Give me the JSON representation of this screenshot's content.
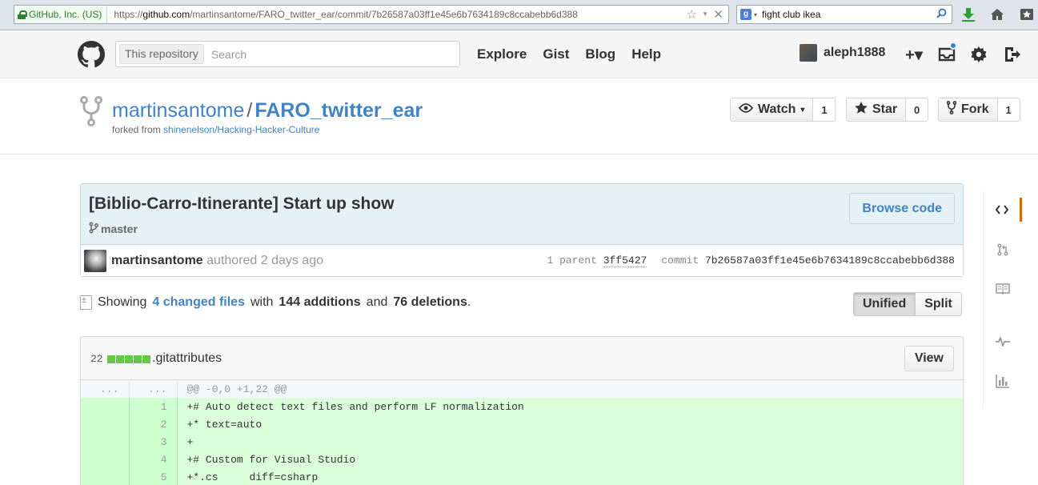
{
  "browser": {
    "site_identity": "GitHub, Inc. (US)",
    "url_prefix": "https://",
    "url_domain": "github.com",
    "url_path": "/martinsantome/FARO_twitter_ear/commit/7b26587a03ff1e45e6b7634189c8ccabebb6d388",
    "search_value": "fight club ikea"
  },
  "header": {
    "search_scope": "This repository",
    "search_placeholder": "Search",
    "nav": [
      "Explore",
      "Gist",
      "Blog",
      "Help"
    ],
    "username": "aleph1888",
    "plus_label": "+▾"
  },
  "repo": {
    "owner": "martinsantome",
    "separator": "/",
    "name": "FARO_twitter_ear",
    "forked_prefix": "forked from ",
    "forked_from": "shinenelson/Hacking-Hacker-Culture",
    "watch_label": "Watch",
    "watch_count": "1",
    "star_label": "Star",
    "star_count": "0",
    "fork_label": "Fork",
    "fork_count": "1"
  },
  "commit": {
    "title": "[Biblio-Carro-Itinerante] Start up show",
    "branch": "master",
    "browse_label": "Browse code",
    "author": "martinsantome",
    "authored": "authored 2 days ago",
    "parent_label": "1 parent",
    "parent_sha": "3ff5427",
    "commit_label": "commit",
    "sha": "7b26587a03ff1e45e6b7634189c8ccabebb6d388"
  },
  "summary": {
    "showing": "Showing",
    "changed_files": "4 changed files",
    "with": "with",
    "additions": "144 additions",
    "and": "and",
    "deletions": "76 deletions",
    "end": ".",
    "unified_label": "Unified",
    "split_label": "Split",
    "selected": "Unified"
  },
  "file": {
    "change_count": "22",
    "name": ".gitattributes",
    "view_label": "View",
    "hunk_marker": "...",
    "hunk": "@@ -0,0 +1,22 @@",
    "lines": [
      {
        "num": "1",
        "code": "+# Auto detect text files and perform LF normalization"
      },
      {
        "num": "2",
        "code": "+* text=auto"
      },
      {
        "num": "3",
        "code": "+"
      },
      {
        "num": "4",
        "code": "+# Custom for Visual Studio"
      },
      {
        "num": "5",
        "code": "+*.cs     diff=csharp"
      }
    ]
  },
  "colors": {
    "link": "#4183c4",
    "addition": "#6cc644",
    "added_line_bg": "#dbffdb",
    "commit_header_bg": "#e6f1f6",
    "active_nav": "#d26911"
  },
  "sidenav": [
    "code-icon",
    "pull-request-icon",
    "wiki-icon",
    "pulse-icon",
    "graphs-icon"
  ]
}
